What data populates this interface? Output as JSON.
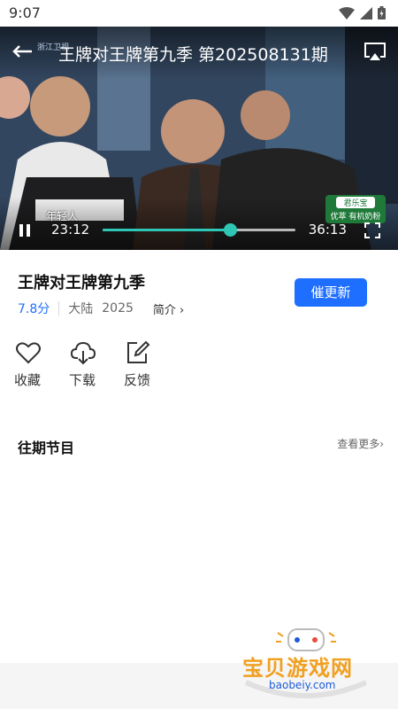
{
  "status_bar": {
    "time": "9:07"
  },
  "player": {
    "title": "王牌对王牌第九季 第202508131期",
    "current_time": "23:12",
    "total_time": "36:13",
    "progress": 0.66,
    "caption": "年轻人",
    "channel_text": "浙江卫视",
    "sponsor_brand": "君乐宝",
    "sponsor_text": "优萃 有机奶粉"
  },
  "show": {
    "title": "王牌对王牌第九季",
    "rating": "7.8分",
    "region": "大陆",
    "year": "2025",
    "intro_label": "简介 ›",
    "follow_label": "催更新"
  },
  "actions": [
    {
      "label": "收藏",
      "icon": "heart-icon"
    },
    {
      "label": "下载",
      "icon": "cloud-download-icon"
    },
    {
      "label": "反馈",
      "icon": "edit-icon"
    }
  ],
  "episodes_section": {
    "title": "往期节目",
    "more_label": "查看更多›"
  },
  "watermark": {
    "text": "宝贝游戏网",
    "url": "baobeiy.com"
  },
  "colors": {
    "accent": "#1e6fff",
    "progress": "#2ec7b6",
    "watermark": "#f0a020"
  }
}
